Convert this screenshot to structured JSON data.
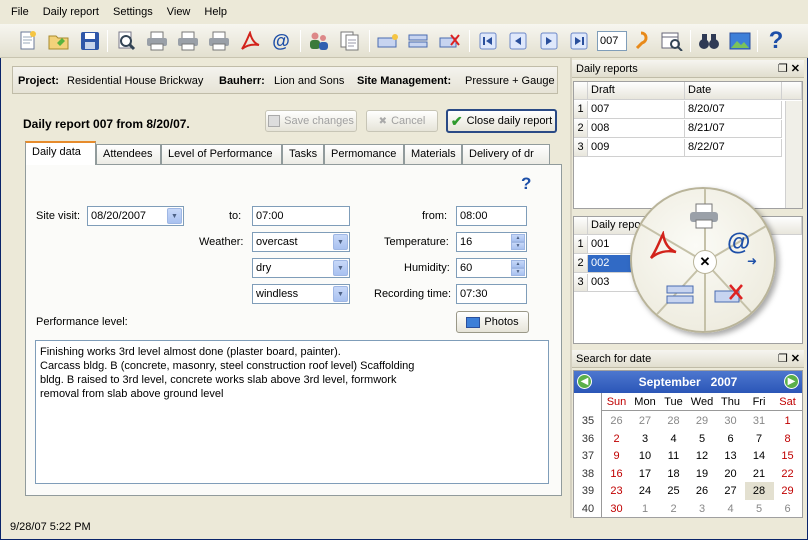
{
  "menu": [
    "File",
    "Daily report",
    "Settings",
    "View",
    "Help"
  ],
  "toolbar": {
    "record_number": "007"
  },
  "project_bar": {
    "project_label": "Project:",
    "project_value": "Residential House Brickway",
    "bauherr_label": "Bauherr:",
    "bauherr_value": "Lion and Sons",
    "site_label": "Site Management:",
    "site_value": "Pressure + Gauge"
  },
  "report": {
    "title": "Daily report 007 from 8/20/07.",
    "save_label": "Save changes",
    "cancel_label": "Cancel",
    "close_label": "Close daily report"
  },
  "tabs": [
    "Daily data",
    "Attendees",
    "Level of Performance",
    "Tasks",
    "Permomance",
    "Materials",
    "Delivery of dr"
  ],
  "form": {
    "help": "?",
    "site_visit_label": "Site visit:",
    "site_visit_value": "08/20/2007",
    "to_label": "to:",
    "to_value": "07:00",
    "from_label": "from:",
    "from_value": "08:00",
    "weather_label": "Weather:",
    "weather1": "overcast",
    "weather2": "dry",
    "weather3": "windless",
    "temperature_label": "Temperature:",
    "temperature_value": "16",
    "humidity_label": "Humidity:",
    "humidity_value": "60",
    "recording_label": "Recording time:",
    "recording_value": "07:30",
    "photos_label": "Photos",
    "performance_label": "Performance level:",
    "performance_lines": [
      "Finishing works 3rd level almost done (plaster board, painter).",
      "Carcass bldg. B (concrete, masonry, steel construction roof level) Scaffolding",
      "bldg. B raised to 3rd level, concrete works slab above 3rd level, formwork",
      "removal from slab above ground level"
    ]
  },
  "daily_reports_panel": {
    "title": "Daily reports",
    "headers": [
      "Draft",
      "Date"
    ],
    "rows": [
      {
        "n": "1",
        "draft": "007",
        "date": "8/20/07"
      },
      {
        "n": "2",
        "draft": "008",
        "date": "8/21/07"
      },
      {
        "n": "3",
        "draft": "009",
        "date": "8/22/07"
      }
    ]
  },
  "second_grid": {
    "header": "Daily repo",
    "rows": [
      {
        "n": "1",
        "v": "001"
      },
      {
        "n": "2",
        "v": "002"
      },
      {
        "n": "3",
        "v": "003"
      }
    ]
  },
  "search_panel": {
    "title": "Search for date",
    "month": "September",
    "year": "2007",
    "weekdays": [
      "Sun",
      "Mon",
      "Tue",
      "Wed",
      "Thu",
      "Fri",
      "Sat"
    ],
    "weeks": [
      {
        "wk": "35",
        "days": [
          "26",
          "27",
          "28",
          "29",
          "30",
          "31",
          "1"
        ]
      },
      {
        "wk": "36",
        "days": [
          "2",
          "3",
          "4",
          "5",
          "6",
          "7",
          "8"
        ]
      },
      {
        "wk": "37",
        "days": [
          "9",
          "10",
          "11",
          "12",
          "13",
          "14",
          "15"
        ]
      },
      {
        "wk": "38",
        "days": [
          "16",
          "17",
          "18",
          "19",
          "20",
          "21",
          "22"
        ]
      },
      {
        "wk": "39",
        "days": [
          "23",
          "24",
          "25",
          "26",
          "27",
          "28",
          "29"
        ]
      },
      {
        "wk": "40",
        "days": [
          "30",
          "1",
          "2",
          "3",
          "4",
          "5",
          "6"
        ]
      }
    ]
  },
  "status": "9/28/07 5:22 PM",
  "colors": {
    "accent": "#316ac5",
    "tab_highlight": "#e68b2c",
    "weekend": "#c00000"
  }
}
